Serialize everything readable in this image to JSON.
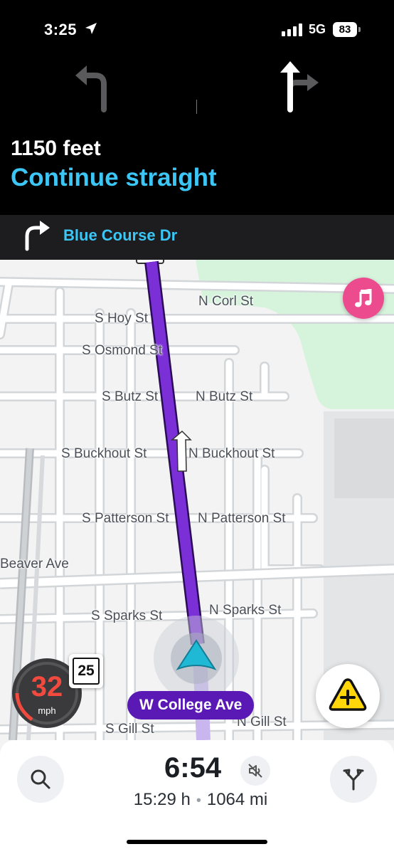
{
  "status_bar": {
    "time": "3:25",
    "network": "5G",
    "battery": "83"
  },
  "navigation": {
    "lane_guidance": [
      "turn-left",
      "straight-or-right"
    ],
    "distance": "1150 feet",
    "instruction": "Continue straight",
    "next_turn": {
      "direction": "right",
      "street": "Blue Course Dr"
    }
  },
  "map": {
    "street_labels": [
      "N Corl St",
      "S Hoy St",
      "S Osmond St",
      "S Butz St",
      "N Butz St",
      "S Buckhout St",
      "N Buckhout St",
      "S Patterson St",
      "N Patterson St",
      "Beaver Ave",
      "S Sparks St",
      "N Sparks St",
      "S Gill St",
      "N Gill St"
    ],
    "current_street": "W College Ave",
    "route_color": "#7b2fd6",
    "park_color": "#d6f3dc"
  },
  "speedometer": {
    "speed": "32",
    "unit": "mph",
    "speed_limit": "25"
  },
  "trip": {
    "eta": "6:54",
    "duration": "15:29 h",
    "separator": "•",
    "distance": "1064 mi"
  },
  "colors": {
    "accent_blue": "#3cc6f5",
    "music_pink": "#ec4c8e",
    "report_yellow": "#ffd60a",
    "street_pill": "#5a19b5",
    "speed_red": "#f24a3f"
  }
}
